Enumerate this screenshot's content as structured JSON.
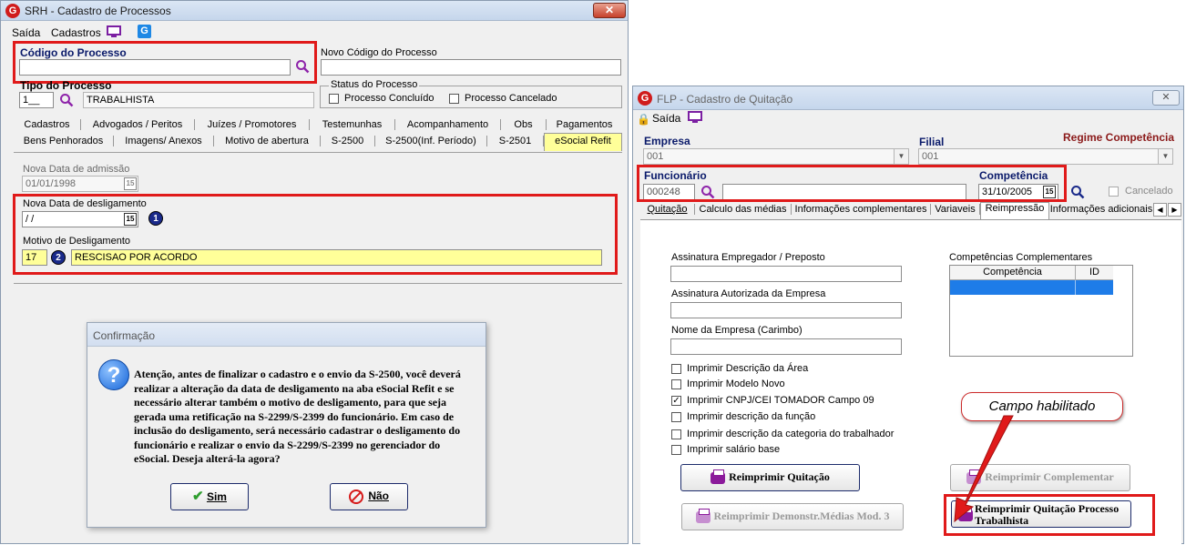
{
  "srh": {
    "title": "SRH - Cadastro de Processos",
    "menu": [
      "Saída",
      "Cadastros"
    ],
    "codigo_label": "Código do Processo",
    "novo_codigo_label": "Novo Código do Processo",
    "tipo_label": "Tipo do Processo",
    "tipo_code": "1__",
    "tipo_value": "TRABALHISTA",
    "status_label": "Status do Processo",
    "processo_concluido": "Processo Concluído",
    "processo_cancelado": "Processo Cancelado",
    "tabs_row1": [
      "Cadastros",
      "Advogados / Peritos",
      "Juízes / Promotores",
      "Testemunhas",
      "Acompanhamento",
      "Obs",
      "Pagamentos"
    ],
    "tabs_row2": [
      "Bens Penhorados",
      "Imagens/ Anexos",
      "Motivo de abertura",
      "S-2500",
      "S-2500(Inf. Período)",
      "S-2501",
      "eSocial Refit"
    ],
    "nova_admissao_label": "Nova Data de admissão",
    "nova_admissao_value": "01/01/1998",
    "nova_deslig_label": "Nova Data de desligamento",
    "nova_deslig_value": " /  /",
    "motivo_label": "Motivo de Desligamento",
    "motivo_code": "17",
    "motivo_value": "RESCISAO POR ACORDO",
    "badge1": "1",
    "badge2": "2",
    "cal_icon": "15"
  },
  "dialog": {
    "title": "Confirmação",
    "icon": "?",
    "message": "Atenção, antes de finalizar o cadastro e o envio da S-2500, você deverá realizar a alteração da data de desligamento na aba eSocial Refit  e se necessário alterar também o motivo de desligamento, para que seja gerada uma retificação na S-2299/S-2399 do funcionário. Em caso de inclusão do desligamento, será necessário cadastrar o desligamento do funcionário e realizar o envio da S-2299/S-2399 no gerenciador do eSocial. Deseja alterá-la agora?",
    "yes": "Sim",
    "no": "Não"
  },
  "flp": {
    "title": "FLP - Cadastro de Quitação",
    "menu_saida": "Saída",
    "empresa_label": "Empresa",
    "empresa_value": "001",
    "filial_label": "Filial",
    "filial_value": "001",
    "regime_label": "Regime Competência",
    "funcionario_label": "Funcionário",
    "funcionario_value": "000248",
    "competencia_label": "Competência",
    "competencia_value": "31/10/2005",
    "cancelado_label": "Cancelado",
    "tabs": [
      "Quitação",
      "Calculo das médias",
      "Informações complementares",
      "Variaveis",
      "Reimpressão",
      "Informações adicionais"
    ],
    "assinatura_emp_label": "Assinatura Empregador / Preposto",
    "assinatura_aut_label": "Assinatura Autorizada da Empresa",
    "nome_empresa_label": "Nome da Empresa (Carimbo)",
    "comp_compl_label": "Competências Complementares",
    "table_headers": [
      "Competência",
      "ID"
    ],
    "checkboxes": [
      {
        "label": "Imprimir Descrição da Área",
        "checked": false
      },
      {
        "label": "Imprimir Modelo Novo",
        "checked": false
      },
      {
        "label": "Imprimir CNPJ/CEI TOMADOR Campo 09",
        "checked": true
      },
      {
        "label": "Imprimir descrição da função",
        "checked": false
      },
      {
        "label": "Imprimir descrição da categoria do trabalhador",
        "checked": false
      },
      {
        "label": "Imprimir salário base",
        "checked": false
      }
    ],
    "btn_reimprimir_quitacao": "Reimprimir Quitação",
    "btn_reimprimir_complementar": "Reimprimir Complementar",
    "btn_reimprimir_demonstr": "Reimprimir Demonstr.Médias Mod. 3",
    "btn_reimprimir_processo_l1": "Reimprimir Quitação Processo",
    "btn_reimprimir_processo_l2": "Trabalhista",
    "callout": "Campo habilitado"
  },
  "colors": {
    "highlight_red": "#e01a1a",
    "field_yellow": "#ffff99",
    "selection_blue": "#1e7ce8"
  }
}
